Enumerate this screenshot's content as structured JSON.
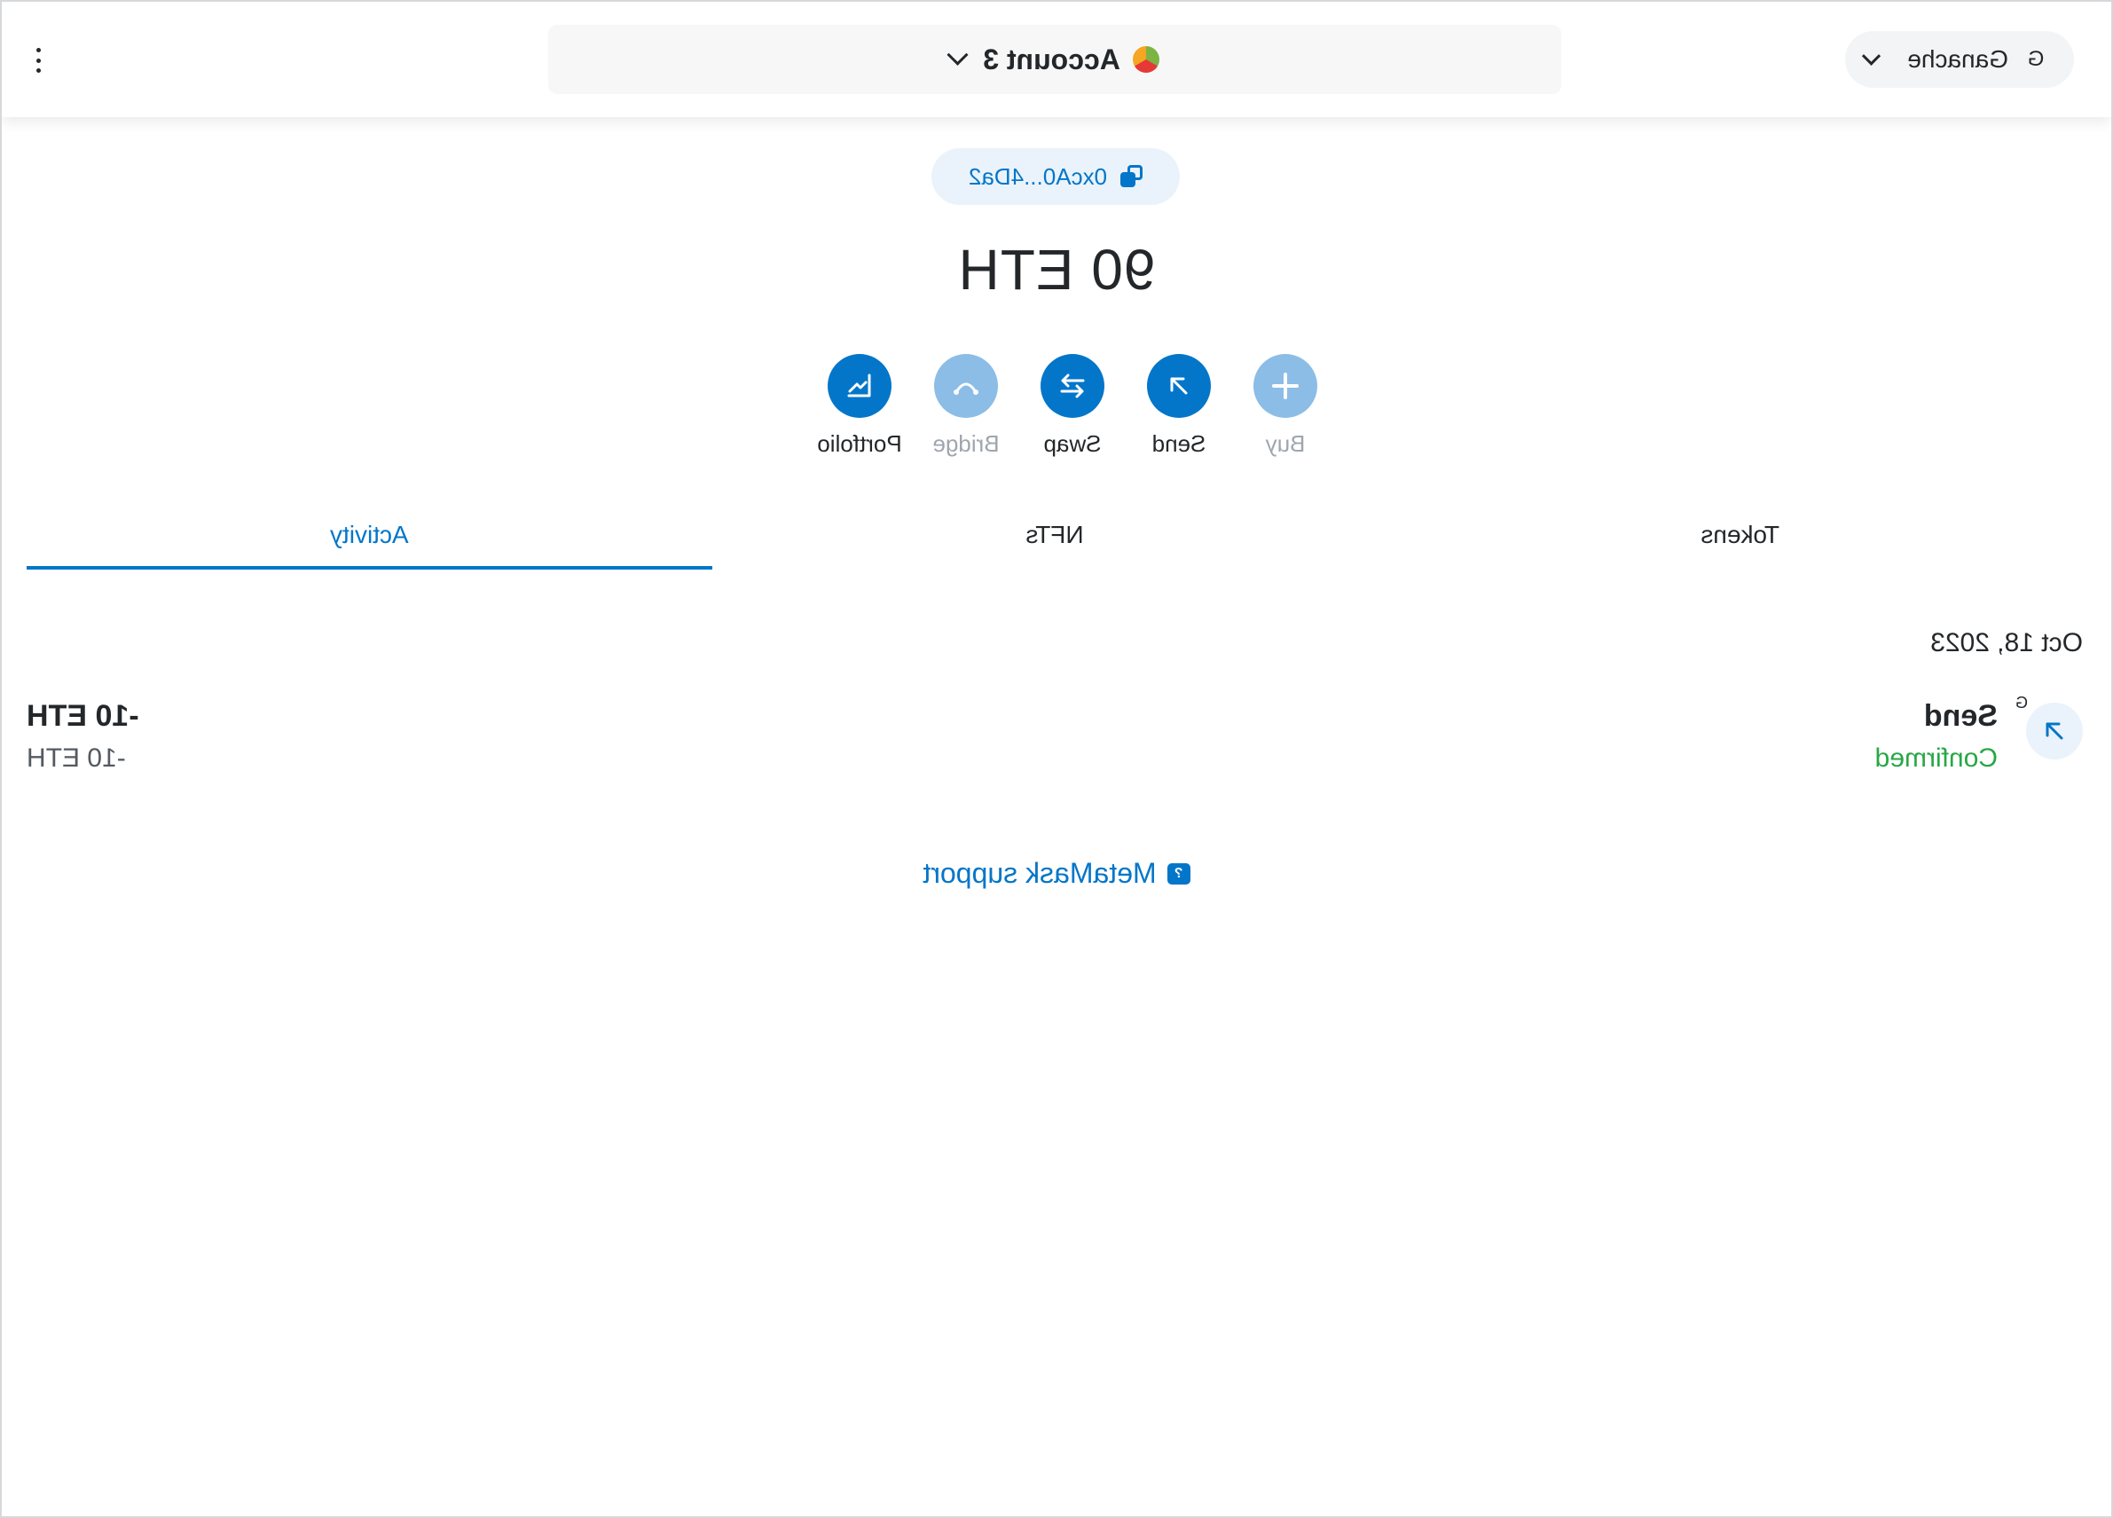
{
  "header": {
    "network": {
      "label": "Ganache",
      "avatar_letter": "G"
    },
    "account": {
      "name": "Account 3"
    },
    "menu_icon": "kebab-menu-icon"
  },
  "address": {
    "short": "0xcA0...4Da2",
    "icon": "copy-icon"
  },
  "balance": {
    "text": "90 ETH"
  },
  "actions": [
    {
      "label": "Buy",
      "icon": "plus-icon",
      "disabled": true
    },
    {
      "label": "Send",
      "icon": "arrow-up-right-icon",
      "disabled": false
    },
    {
      "label": "Swap",
      "icon": "swap-icon",
      "disabled": false
    },
    {
      "label": "Bridge",
      "icon": "bridge-icon",
      "disabled": true
    },
    {
      "label": "Portfolio",
      "icon": "chart-icon",
      "disabled": false
    }
  ],
  "tabs": [
    {
      "label": "Tokens",
      "active": false
    },
    {
      "label": "NFTs",
      "active": false
    },
    {
      "label": "Activity",
      "active": true
    }
  ],
  "activity": {
    "groups": [
      {
        "date": "Oct 18, 2023",
        "items": [
          {
            "title": "Send",
            "status": "Confirmed",
            "network_badge": "G",
            "amount": "-10 ETH",
            "fiat": "-10 ETH"
          }
        ]
      }
    ]
  },
  "support": {
    "label": "MetaMask support",
    "icon": "help-bubble-icon"
  },
  "colors": {
    "primary": "#0376c9",
    "primary_disabled": "#8bbde6",
    "success": "#28a745",
    "text": "#24272a",
    "muted": "#9fa6ae"
  }
}
